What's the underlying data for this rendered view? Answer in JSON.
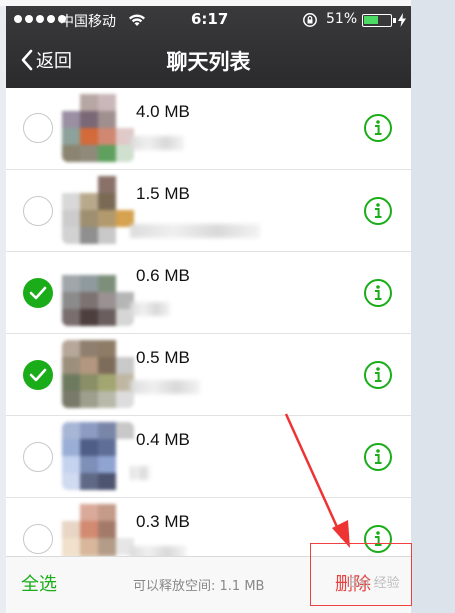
{
  "status_bar": {
    "carrier": "中国移动",
    "time": "6:17",
    "battery": "51%",
    "battery_level": 0.51,
    "icons": [
      "signal-dots-icon",
      "wifi-icon",
      "rotation-lock-icon",
      "battery-icon",
      "charging-bolt-icon"
    ]
  },
  "nav": {
    "back_label": "返回",
    "title": "聊天列表"
  },
  "rows": [
    {
      "size": "4.0 MB",
      "checked": false
    },
    {
      "size": "1.5 MB",
      "checked": false
    },
    {
      "size": "0.6 MB",
      "checked": true
    },
    {
      "size": "0.5 MB",
      "checked": true
    },
    {
      "size": "0.4 MB",
      "checked": false
    },
    {
      "size": "0.3 MB",
      "checked": false
    }
  ],
  "bottom_bar": {
    "select_all": "全选",
    "free_space": "可以释放空间: 1.1 MB",
    "delete": "删除"
  },
  "watermark": "Bai 经验",
  "colors": {
    "accent_green": "#1aad19",
    "delete_red": "#e64340",
    "nav_bg": "#2f2f31",
    "annotation_red": "#f04040"
  }
}
